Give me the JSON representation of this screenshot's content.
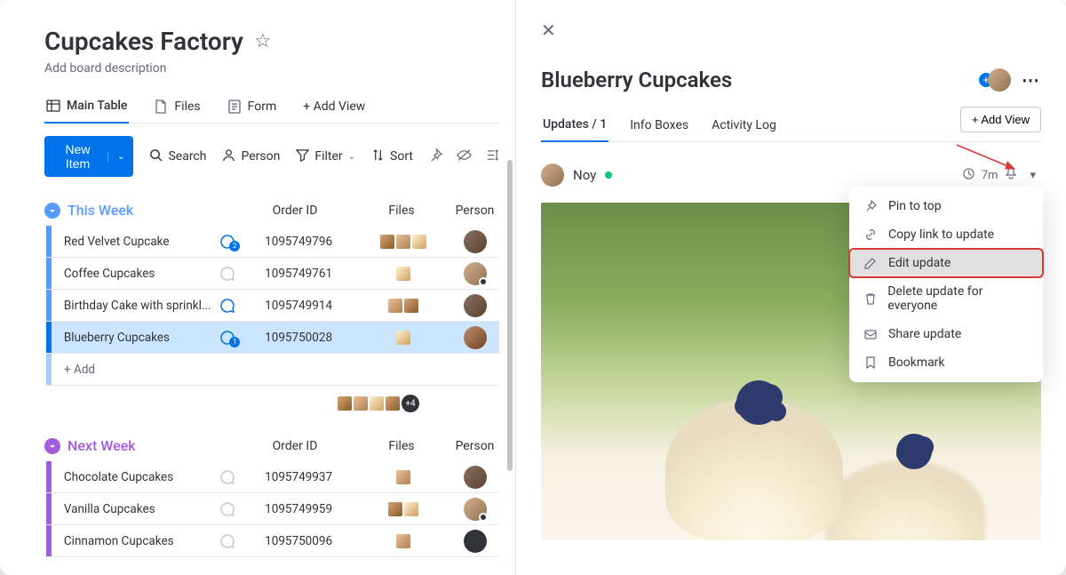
{
  "board": {
    "title": "Cupcakes Factory",
    "description_placeholder": "Add board description"
  },
  "views": {
    "main_table": "Main Table",
    "files": "Files",
    "form": "Form",
    "add_view": "+  Add View"
  },
  "toolbar": {
    "new_item": "New Item",
    "search": "Search",
    "person": "Person",
    "filter": "Filter",
    "sort": "Sort"
  },
  "columns": {
    "order_id": "Order ID",
    "files": "Files",
    "person": "Person"
  },
  "groups": [
    {
      "name": "This Week",
      "items": [
        {
          "name": "Red Velvet Cupcake",
          "order_id": "1095749796",
          "chat_active": true,
          "chat_count": "2",
          "files": 3
        },
        {
          "name": "Coffee Cupcakes",
          "order_id": "1095749761",
          "chat_active": false,
          "files": 1
        },
        {
          "name": "Birthday Cake with sprinkl...",
          "order_id": "1095749914",
          "chat_active": true,
          "files": 2
        },
        {
          "name": "Blueberry Cupcakes",
          "order_id": "1095750028",
          "chat_active": true,
          "chat_count": "1",
          "files": 1,
          "selected": true
        }
      ],
      "add_label": "+ Add",
      "files_more": "+4"
    },
    {
      "name": "Next Week",
      "items": [
        {
          "name": "Chocolate Cupcakes",
          "order_id": "1095749937",
          "chat_active": false,
          "files": 1
        },
        {
          "name": "Vanilla Cupcakes",
          "order_id": "1095749959",
          "chat_active": false,
          "files": 2
        },
        {
          "name": "Cinnamon Cupcakes",
          "order_id": "1095750096",
          "chat_active": false,
          "files": 1
        }
      ]
    }
  ],
  "panel": {
    "title": "Blueberry Cupcakes",
    "tabs": {
      "updates": "Updates / 1",
      "info": "Info Boxes",
      "activity": "Activity Log"
    },
    "add_view": "+ Add View",
    "update": {
      "author": "Noy",
      "time": "7m"
    },
    "dropdown": {
      "pin": "Pin to top",
      "copy": "Copy link to update",
      "edit": "Edit update",
      "delete": "Delete update for everyone",
      "share": "Share update",
      "bookmark": "Bookmark"
    }
  }
}
